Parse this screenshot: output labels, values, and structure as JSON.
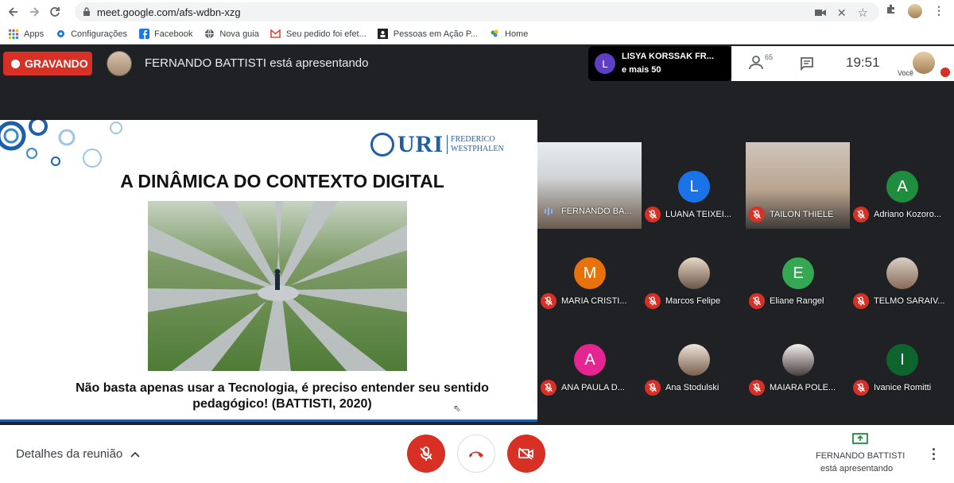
{
  "browser": {
    "url": "meet.google.com/afs-wdbn-xzg",
    "bookmarks": [
      {
        "label": "Apps",
        "icon": "apps-grid-icon"
      },
      {
        "label": "Configurações",
        "icon": "gear-icon"
      },
      {
        "label": "Facebook",
        "icon": "facebook-icon"
      },
      {
        "label": "Nova guia",
        "icon": "globe-icon"
      },
      {
        "label": "Seu pedido foi efet...",
        "icon": "gmail-icon"
      },
      {
        "label": "Pessoas em Ação P...",
        "icon": "people-icon"
      },
      {
        "label": "Home",
        "icon": "pna-icon"
      }
    ]
  },
  "meet": {
    "recording_label": "GRAVANDO",
    "presenting_text": "FERNANDO BATTISTI está apresentando",
    "speaker": {
      "initial": "L",
      "name": "LISYA KORSSAK FR...",
      "more": "e mais 50",
      "color": "#5f3dc4"
    },
    "participant_count": "65",
    "clock": "19:51",
    "you_label": "Você"
  },
  "slide": {
    "title": "A DINÂMICA DO CONTEXTO DIGITAL",
    "logo_main": "URI",
    "logo_sub_1": "FREDERICO",
    "logo_sub_2": "WESTPHALEN",
    "caption_line1": "Não basta apenas usar a Tecnologia, é preciso entender seu sentido",
    "caption_line2": "pedagógico! (BATTISTI, 2020)"
  },
  "participants": [
    {
      "name": "FERNANDO BA...",
      "type": "video",
      "speaking": true
    },
    {
      "name": "LUANA TEIXEI...",
      "type": "initial",
      "initial": "L",
      "color": "#1a73e8"
    },
    {
      "name": "TAILON THIELE",
      "type": "video"
    },
    {
      "name": "Adriano Kozoro...",
      "type": "initial",
      "initial": "A",
      "color": "#1e8e3e"
    },
    {
      "name": "MARIA CRISTI...",
      "type": "initial",
      "initial": "M",
      "color": "#e8710a"
    },
    {
      "name": "Marcos Felipe",
      "type": "photo"
    },
    {
      "name": "Eliane Rangel",
      "type": "initial",
      "initial": "E",
      "color": "#34a853"
    },
    {
      "name": "TELMO SARAIV...",
      "type": "photo"
    },
    {
      "name": "ANA PAULA D...",
      "type": "initial",
      "initial": "A",
      "color": "#e52592"
    },
    {
      "name": "Ana Stodulski",
      "type": "photo"
    },
    {
      "name": "MAIARA POLE...",
      "type": "photo"
    },
    {
      "name": "Ivanice Romitti",
      "type": "initial",
      "initial": "I",
      "color": "#0d652d"
    }
  ],
  "bottom": {
    "details_label": "Detalhes da reunião",
    "presenter_name": "FERNANDO BATTISTI",
    "presenter_status": "está apresentando"
  }
}
